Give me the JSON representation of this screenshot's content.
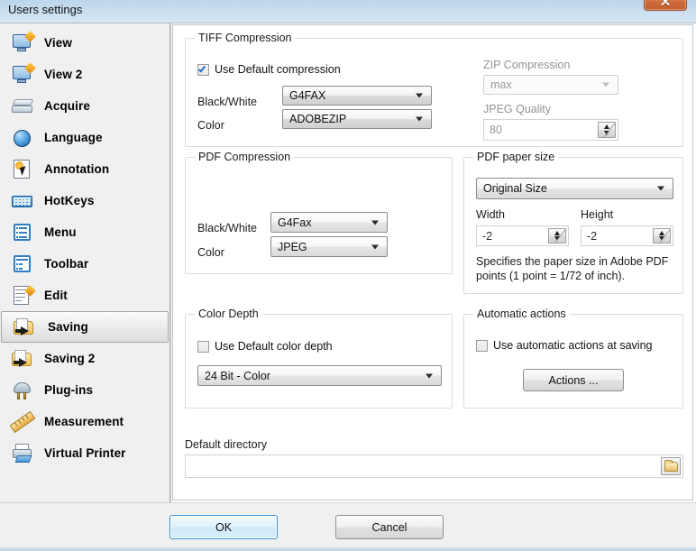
{
  "window": {
    "title": "Users settings",
    "close_label": "✕"
  },
  "sidebar": {
    "items": [
      {
        "label": "View",
        "icon": "monitor-pencil-icon",
        "selected": false
      },
      {
        "label": "View 2",
        "icon": "monitor-pencil-icon",
        "selected": false
      },
      {
        "label": "Acquire",
        "icon": "scanner-icon",
        "selected": false
      },
      {
        "label": "Language",
        "icon": "globe-icon",
        "selected": false
      },
      {
        "label": "Annotation",
        "icon": "annotation-icon",
        "selected": false
      },
      {
        "label": "HotKeys",
        "icon": "keyboard-icon",
        "selected": false
      },
      {
        "label": "Menu",
        "icon": "menu-list-icon",
        "selected": false
      },
      {
        "label": "Toolbar",
        "icon": "toolbar-icon",
        "selected": false
      },
      {
        "label": "Edit",
        "icon": "edit-page-icon",
        "selected": false
      },
      {
        "label": "Saving",
        "icon": "save-folder-icon",
        "selected": true
      },
      {
        "label": "Saving 2",
        "icon": "save-folder-icon",
        "selected": false
      },
      {
        "label": "Plug-ins",
        "icon": "plug-icon",
        "selected": false
      },
      {
        "label": "Measurement",
        "icon": "ruler-icon",
        "selected": false
      },
      {
        "label": "Virtual Printer",
        "icon": "printer-icon",
        "selected": false
      }
    ]
  },
  "tiff_compression": {
    "title": "TIFF Compression",
    "use_default": {
      "label": "Use Default compression",
      "checked": true
    },
    "black_white": {
      "label": "Black/White",
      "value": "G4FAX"
    },
    "color": {
      "label": "Color",
      "value": "ADOBEZIP"
    },
    "zip_compression": {
      "label": "ZIP Compression",
      "value": "max",
      "enabled": false
    },
    "jpeg_quality": {
      "label": "JPEG Quality",
      "value": "80",
      "enabled": false
    }
  },
  "pdf_compression": {
    "title": "PDF Compression",
    "black_white": {
      "label": "Black/White",
      "value": "G4Fax"
    },
    "color": {
      "label": "Color",
      "value": "JPEG"
    }
  },
  "pdf_paper_size": {
    "title": "PDF paper size",
    "size": {
      "value": "Original Size"
    },
    "width": {
      "label": "Width",
      "value": "-2"
    },
    "height": {
      "label": "Height",
      "value": "-2"
    },
    "hint": "Specifies the paper size in Adobe PDF points (1 point = 1/72 of inch)."
  },
  "color_depth": {
    "title": "Color Depth",
    "use_default": {
      "label": "Use Default color depth",
      "checked": false
    },
    "depth": {
      "value": "24 Bit - Color"
    }
  },
  "automatic_actions": {
    "title": "Automatic actions",
    "use_auto": {
      "label": "Use automatic actions at saving",
      "checked": false
    },
    "actions_button": "Actions ..."
  },
  "default_directory": {
    "label": "Default directory",
    "value": "",
    "browse_icon": "folder-icon"
  },
  "footer": {
    "ok": "OK",
    "cancel": "Cancel"
  },
  "colors": {
    "accent": "#3c94d4",
    "titlebar": "#c9dced",
    "close": "#cf6b3a",
    "group_border": "#d6dde3",
    "disabled_text": "#9a9a9a"
  }
}
